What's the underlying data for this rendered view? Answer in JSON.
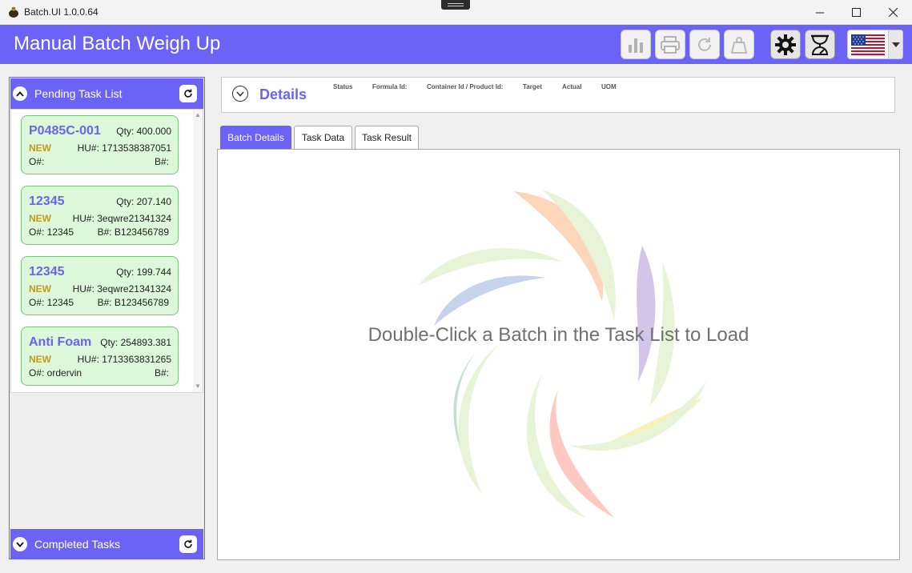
{
  "window": {
    "title": "Batch.UI 1.0.0.64"
  },
  "header": {
    "title": "Manual Batch Weigh Up",
    "buttons": [
      {
        "icon": "bar-chart-icon",
        "enabled": false
      },
      {
        "icon": "printer-icon",
        "enabled": false
      },
      {
        "icon": "refresh-icon",
        "enabled": false
      },
      {
        "icon": "weight-icon",
        "enabled": false
      },
      {
        "icon": "gear-icon",
        "enabled": true
      },
      {
        "icon": "scale-icon",
        "enabled": true
      }
    ],
    "language_flag": "us-flag-icon"
  },
  "pending": {
    "title": "Pending Task List",
    "tasks": [
      {
        "id": "P0485C-001",
        "qty": "Qty: 400.000",
        "status": "NEW",
        "hu": "HU#: 1713538387051",
        "o": "O#:",
        "b": "B#:"
      },
      {
        "id": "12345",
        "qty": "Qty: 207.140",
        "status": "NEW",
        "hu": "HU#: 3eqwre21341324",
        "o": "O#: 12345",
        "b": "B#: B123456789"
      },
      {
        "id": "12345",
        "qty": "Qty: 199.744",
        "status": "NEW",
        "hu": "HU#: 3eqwre21341324",
        "o": "O#: 12345",
        "b": "B#: B123456789"
      },
      {
        "id": "Anti Foam",
        "qty": "Qty: 254893.381",
        "status": "NEW",
        "hu": "HU#: 1713363831265",
        "o": "O#: ordervin",
        "b": "B#:"
      }
    ]
  },
  "completed": {
    "title": "Completed Tasks"
  },
  "details": {
    "title": "Details",
    "columns": [
      "Status",
      "Formula Id:",
      "Container Id / Product Id:",
      "Target",
      "Actual",
      "UOM"
    ]
  },
  "tabs": [
    "Batch Details",
    "Task Data",
    "Task Result"
  ],
  "content": {
    "hint": "Double-Click a Batch in the Task List to Load"
  },
  "colors": {
    "accent": "#6b63f5",
    "card_bg": "#dcf7d9",
    "card_border": "#79c37d",
    "status_new": "#c79a1b"
  }
}
